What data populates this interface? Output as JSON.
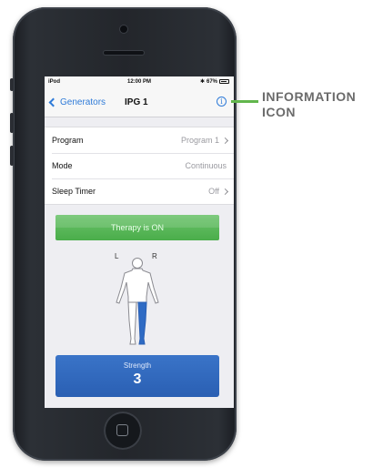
{
  "status_bar": {
    "carrier": "iPod",
    "time": "12:00 PM",
    "battery": "67%"
  },
  "nav": {
    "back_label": "Generators",
    "title": "IPG 1"
  },
  "settings": [
    {
      "label": "Program",
      "value": "Program 1"
    },
    {
      "label": "Mode",
      "value": "Continuous"
    },
    {
      "label": "Sleep Timer",
      "value": "Off"
    }
  ],
  "therapy_status": "Therapy is ON",
  "body_map": {
    "left_label": "L",
    "right_label": "R"
  },
  "strength": {
    "label": "Strength",
    "value": "3"
  },
  "callout": {
    "text": "INFORMATION ICON"
  },
  "colors": {
    "accent_blue": "#2f7bd8",
    "therapy_green": "#4aad4a",
    "strength_blue": "#2a5fb3",
    "callout_green": "#62b64c",
    "leg_highlight": "#2f6bc4"
  },
  "icons": {
    "back": "chevron-left-icon",
    "info": "info-icon",
    "bluetooth": "bluetooth-icon",
    "battery": "battery-icon"
  }
}
